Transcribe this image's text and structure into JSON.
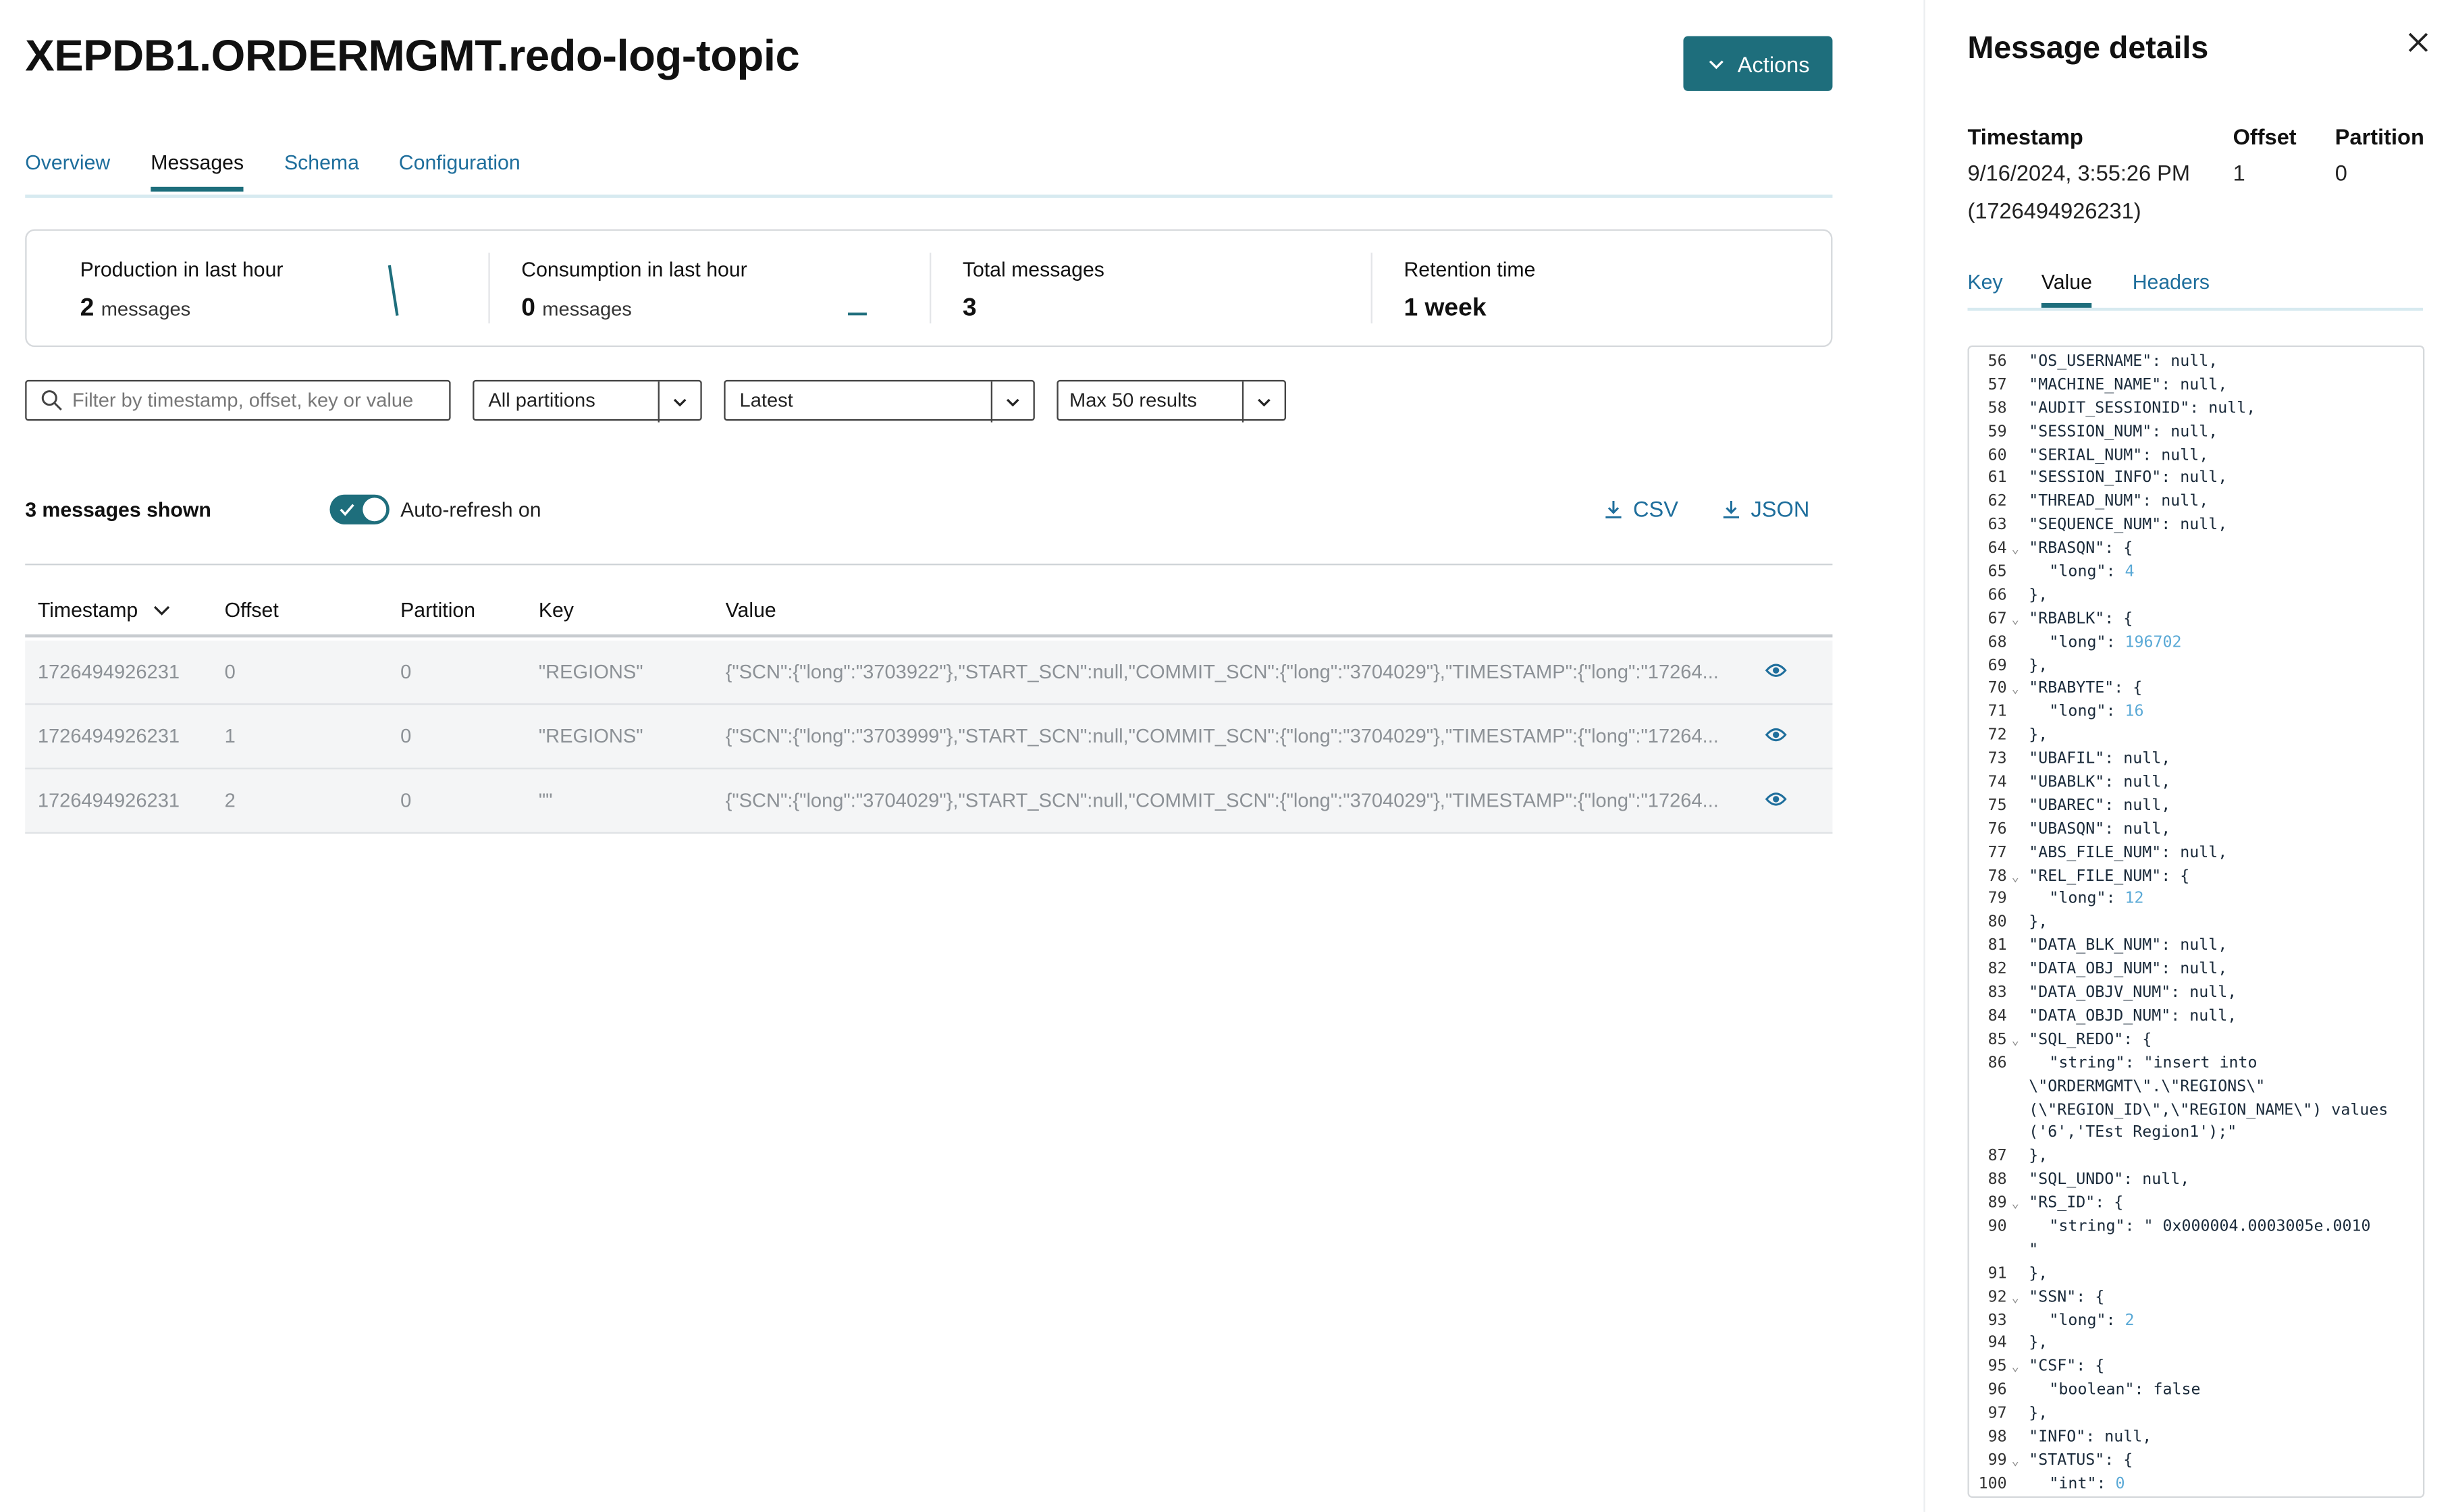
{
  "page": {
    "title": "XEPDB1.ORDERMGMT.redo-log-topic",
    "actions_label": "Actions",
    "tabs": [
      "Overview",
      "Messages",
      "Schema",
      "Configuration"
    ],
    "active_tab": "Messages"
  },
  "stats": {
    "production": {
      "label": "Production in last hour",
      "value": "2",
      "unit": "messages"
    },
    "consumption": {
      "label": "Consumption in last hour",
      "value": "0",
      "unit": "messages"
    },
    "total": {
      "label": "Total messages",
      "value": "3"
    },
    "retention": {
      "label": "Retention time",
      "value": "1 week"
    }
  },
  "filters": {
    "search_placeholder": "Filter by timestamp, offset, key or value",
    "partition": "All partitions",
    "offset": "Latest",
    "limit": "Max 50 results"
  },
  "toolbar": {
    "shown": "3 messages shown",
    "auto_refresh": "Auto-refresh on",
    "csv": "CSV",
    "json": "JSON"
  },
  "table": {
    "columns": [
      "Timestamp",
      "Offset",
      "Partition",
      "Key",
      "Value"
    ],
    "rows": [
      {
        "timestamp": "1726494926231",
        "offset": "0",
        "partition": "0",
        "key": "\"REGIONS\"",
        "value": "{\"SCN\":{\"long\":\"3703922\"},\"START_SCN\":null,\"COMMIT_SCN\":{\"long\":\"3704029\"},\"TIMESTAMP\":{\"long\":\"17264..."
      },
      {
        "timestamp": "1726494926231",
        "offset": "1",
        "partition": "0",
        "key": "\"REGIONS\"",
        "value": "{\"SCN\":{\"long\":\"3703999\"},\"START_SCN\":null,\"COMMIT_SCN\":{\"long\":\"3704029\"},\"TIMESTAMP\":{\"long\":\"17264..."
      },
      {
        "timestamp": "1726494926231",
        "offset": "2",
        "partition": "0",
        "key": "\"\"",
        "value": "{\"SCN\":{\"long\":\"3704029\"},\"START_SCN\":null,\"COMMIT_SCN\":{\"long\":\"3704029\"},\"TIMESTAMP\":{\"long\":\"17264..."
      }
    ]
  },
  "details": {
    "title": "Message details",
    "timestamp_label": "Timestamp",
    "timestamp_value": "9/16/2024, 3:55:26 PM",
    "timestamp_epoch": "(1726494926231)",
    "offset_label": "Offset",
    "offset_value": "1",
    "partition_label": "Partition",
    "partition_value": "0",
    "tabs": [
      "Key",
      "Value",
      "Headers"
    ],
    "active_tab": "Value",
    "code_lines": [
      {
        "n": "56",
        "text": "\"OS_USERNAME\": null,",
        "indent": 1
      },
      {
        "n": "57",
        "text": "\"MACHINE_NAME\": null,",
        "indent": 1
      },
      {
        "n": "58",
        "text": "\"AUDIT_SESSIONID\": null,",
        "indent": 1
      },
      {
        "n": "59",
        "text": "\"SESSION_NUM\": null,",
        "indent": 1
      },
      {
        "n": "60",
        "text": "\"SERIAL_NUM\": null,",
        "indent": 1
      },
      {
        "n": "61",
        "text": "\"SESSION_INFO\": null,",
        "indent": 1
      },
      {
        "n": "62",
        "text": "\"THREAD_NUM\": null,",
        "indent": 1
      },
      {
        "n": "63",
        "text": "\"SEQUENCE_NUM\": null,",
        "indent": 1
      },
      {
        "n": "64",
        "text": "\"RBASQN\": {",
        "indent": 1,
        "fold": true
      },
      {
        "n": "65",
        "text": "\"long\": ",
        "num": "4",
        "indent": 2
      },
      {
        "n": "66",
        "text": "},",
        "indent": 1
      },
      {
        "n": "67",
        "text": "\"RBABLK\": {",
        "indent": 1,
        "fold": true
      },
      {
        "n": "68",
        "text": "\"long\": ",
        "num": "196702",
        "indent": 2
      },
      {
        "n": "69",
        "text": "},",
        "indent": 1
      },
      {
        "n": "70",
        "text": "\"RBABYTE\": {",
        "indent": 1,
        "fold": true
      },
      {
        "n": "71",
        "text": "\"long\": ",
        "num": "16",
        "indent": 2
      },
      {
        "n": "72",
        "text": "},",
        "indent": 1
      },
      {
        "n": "73",
        "text": "\"UBAFIL\": null,",
        "indent": 1
      },
      {
        "n": "74",
        "text": "\"UBABLK\": null,",
        "indent": 1
      },
      {
        "n": "75",
        "text": "\"UBAREC\": null,",
        "indent": 1
      },
      {
        "n": "76",
        "text": "\"UBASQN\": null,",
        "indent": 1
      },
      {
        "n": "77",
        "text": "\"ABS_FILE_NUM\": null,",
        "indent": 1
      },
      {
        "n": "78",
        "text": "\"REL_FILE_NUM\": {",
        "indent": 1,
        "fold": true
      },
      {
        "n": "79",
        "text": "\"long\": ",
        "num": "12",
        "indent": 2
      },
      {
        "n": "80",
        "text": "},",
        "indent": 1
      },
      {
        "n": "81",
        "text": "\"DATA_BLK_NUM\": null,",
        "indent": 1
      },
      {
        "n": "82",
        "text": "\"DATA_OBJ_NUM\": null,",
        "indent": 1
      },
      {
        "n": "83",
        "text": "\"DATA_OBJV_NUM\": null,",
        "indent": 1
      },
      {
        "n": "84",
        "text": "\"DATA_OBJD_NUM\": null,",
        "indent": 1
      },
      {
        "n": "85",
        "text": "\"SQL_REDO\": {",
        "indent": 1,
        "fold": true
      },
      {
        "n": "86",
        "text": "\"string\": \"insert into",
        "indent": 2,
        "cont": [
          "\\\"ORDERMGMT\\\".\\\"REGIONS\\\"",
          "(\\\"REGION_ID\\\",\\\"REGION_NAME\\\") values",
          "('6','TEst Region1');\""
        ]
      },
      {
        "n": "87",
        "text": "},",
        "indent": 1
      },
      {
        "n": "88",
        "text": "\"SQL_UNDO\": null,",
        "indent": 1
      },
      {
        "n": "89",
        "text": "\"RS_ID\": {",
        "indent": 1,
        "fold": true
      },
      {
        "n": "90",
        "text": "\"string\": \" 0x000004.0003005e.0010",
        "indent": 2,
        "cont": [
          "\""
        ]
      },
      {
        "n": "91",
        "text": "},",
        "indent": 1
      },
      {
        "n": "92",
        "text": "\"SSN\": {",
        "indent": 1,
        "fold": true
      },
      {
        "n": "93",
        "text": "\"long\": ",
        "num": "2",
        "indent": 2
      },
      {
        "n": "94",
        "text": "},",
        "indent": 1
      },
      {
        "n": "95",
        "text": "\"CSF\": {",
        "indent": 1,
        "fold": true
      },
      {
        "n": "96",
        "text": "\"boolean\": false",
        "indent": 2
      },
      {
        "n": "97",
        "text": "},",
        "indent": 1
      },
      {
        "n": "98",
        "text": "\"INFO\": null,",
        "indent": 1
      },
      {
        "n": "99",
        "text": "\"STATUS\": {",
        "indent": 1,
        "fold": true
      },
      {
        "n": "100",
        "text": "\"int\": ",
        "num": "0",
        "indent": 2
      }
    ]
  },
  "colors": {
    "accent": "#1e6e7c",
    "link": "#1e6e9c"
  }
}
